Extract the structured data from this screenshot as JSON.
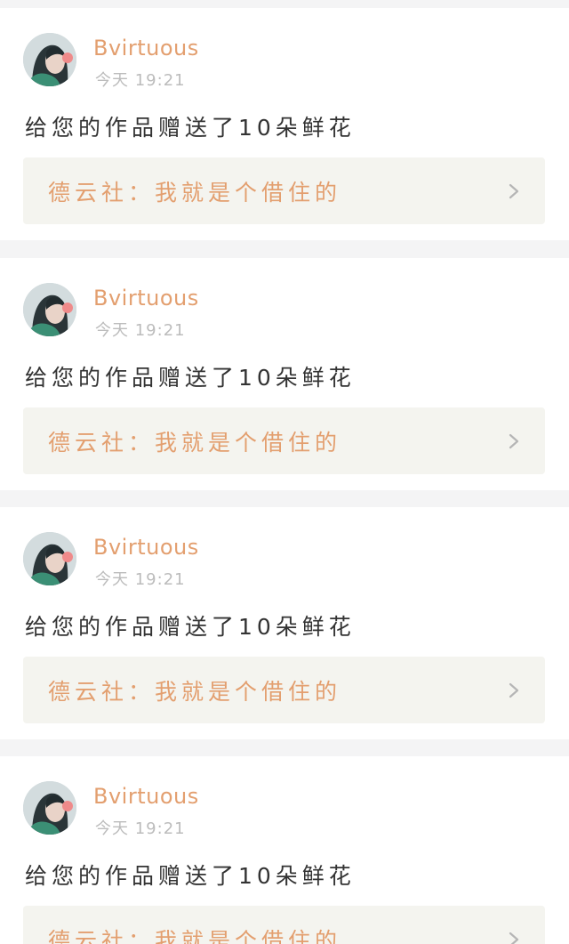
{
  "feed": {
    "items": [
      {
        "username": "Bvirtuous",
        "time": "今天 19:21",
        "message": "给您的作品赠送了10朵鲜花",
        "link_text": "德云社：我就是个借住的",
        "avatar_icon": "user-avatar",
        "chevron_icon": "chevron-right-icon"
      },
      {
        "username": "Bvirtuous",
        "time": "今天 19:21",
        "message": "给您的作品赠送了10朵鲜花",
        "link_text": "德云社：我就是个借住的",
        "avatar_icon": "user-avatar",
        "chevron_icon": "chevron-right-icon"
      },
      {
        "username": "Bvirtuous",
        "time": "今天 19:21",
        "message": "给您的作品赠送了10朵鲜花",
        "link_text": "德云社：我就是个借住的",
        "avatar_icon": "user-avatar",
        "chevron_icon": "chevron-right-icon"
      },
      {
        "username": "Bvirtuous",
        "time": "今天 19:21",
        "message": "给您的作品赠送了10朵鲜花",
        "link_text": "德云社：我就是个借住的",
        "avatar_icon": "user-avatar",
        "chevron_icon": "chevron-right-icon"
      }
    ]
  },
  "colors": {
    "accent": "#e39f6f",
    "page_background": "#f4f4f5",
    "card_background": "#ffffff",
    "link_box_background": "#f4f4ef",
    "time_text": "#bcbcbc",
    "message_text": "#333333",
    "chevron": "#b5b5b5"
  }
}
